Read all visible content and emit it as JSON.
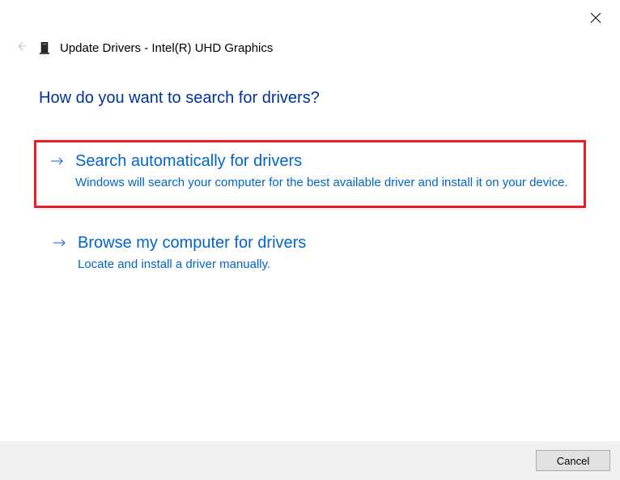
{
  "header": {
    "title": "Update Drivers - Intel(R) UHD Graphics"
  },
  "heading": "How do you want to search for drivers?",
  "options": [
    {
      "title": "Search automatically for drivers",
      "description": "Windows will search your computer for the best available driver and install it on your device."
    },
    {
      "title": "Browse my computer for drivers",
      "description": "Locate and install a driver manually."
    }
  ],
  "footer": {
    "cancel": "Cancel"
  }
}
